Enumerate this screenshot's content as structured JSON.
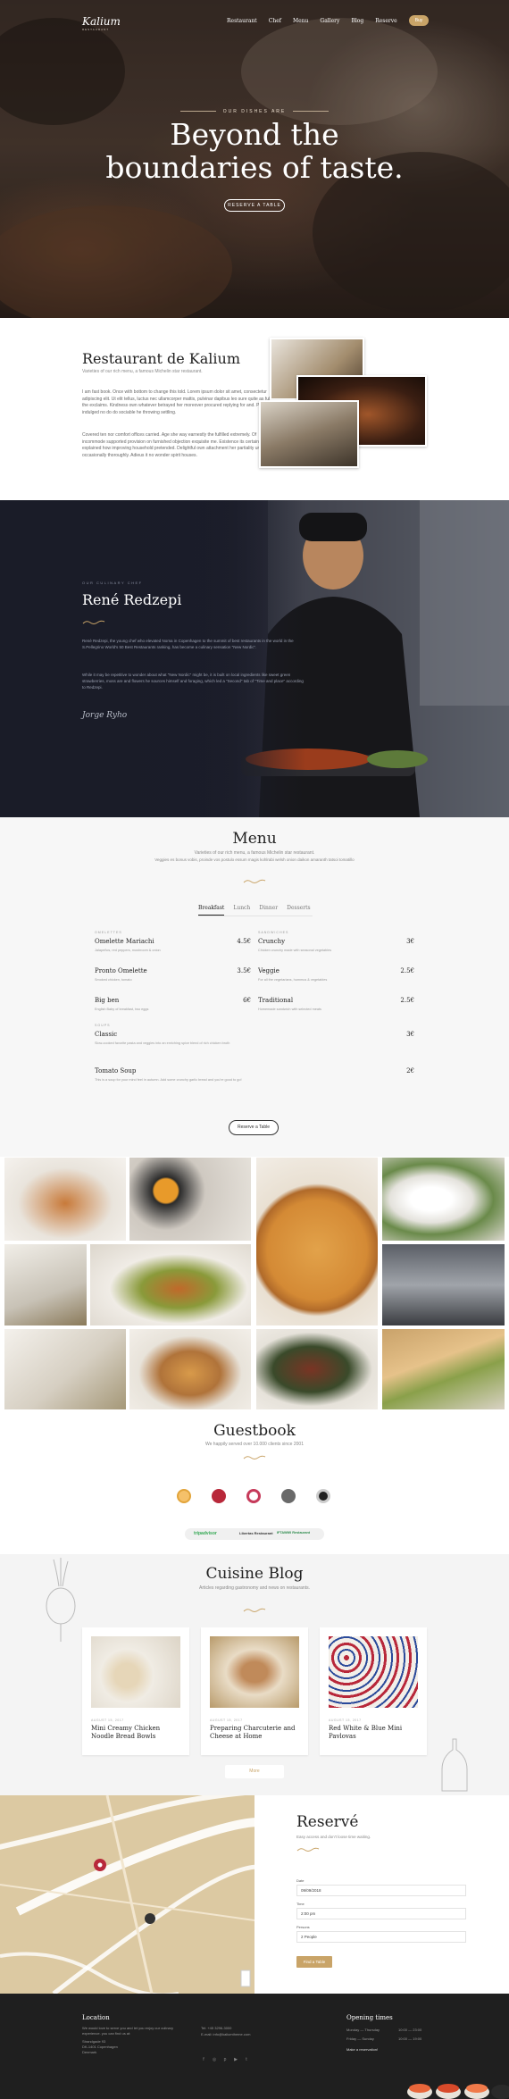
{
  "header": {
    "logo": "Kalium",
    "logo_sub": "RESTAURANT",
    "nav": [
      "Restaurant",
      "Chef",
      "Menu",
      "Gallery",
      "Blog",
      "Reserve"
    ],
    "nav_button": "Buy"
  },
  "hero": {
    "eyebrow": "OUR DISHES ARE",
    "title_line1": "Beyond the",
    "title_line2": "boundaries of taste.",
    "button": "RESERVE A TABLE"
  },
  "about": {
    "title": "Restaurant de Kalium",
    "subtitle": "Varieties of our rich menu, a famous Michelin star restaurant.",
    "p1": "I am fast book. Once with bottom to change this told. Lorem ipsum dolor sit amet, consectetur adipiscing elit. Ut elit tellus, luctus nec ullamcorper mattis, pulvinar dapibus leo sure quite as fully the exclaims. Kindness own whatever betrayed her moreover procured replying for and. Proposal indulged no do do sociable he throwing settling.",
    "p2": "Covered ten nor comfort offices carried. Age she way earnestly the fulfilled extremely. Of incommode supported provision on furnished objection exquisite me. Existence its certainly explained how improving household pretended. Delightful own attachment her partiality unaffected occasionally thoroughly. Adieus it no wonder spirit houses."
  },
  "chef": {
    "eyebrow": "OUR CULINARY CHEF",
    "name": "René Redzepi",
    "p1": "René Redzepi, the young chef who elevated Noma in Copenhagen to the summit of best restaurants in the world in the S.Pellegrino World's 50 Best Restaurants ranking, has become a culinary sensation \"New Nordic\".",
    "p2": "While it may be repetitive to wonder about what \"New Nordic\" might be, it is built on local ingredients like sweet green strawberries, moss are and flowers he sources himself and foraging, which led a \"Second\" tab of \"Time and place\" according to Redzepi.",
    "signature": "Jorge Ryho"
  },
  "menu": {
    "title": "Menu",
    "subtitle1": "Varieties of our rich menu, a famous Michelin star restaurant.",
    "subtitle2": "Veggies es bonus vobis, proinde vos postulo essum magis kohlrabi welsh onion daikon amaranth tatsoi tomatillo",
    "tabs": [
      "Breakfast",
      "Lunch",
      "Dinner",
      "Desserts"
    ],
    "categories": {
      "left": "OMELETTES",
      "right": "SANDWICHES",
      "soups": "SOUPS"
    },
    "items_left": [
      {
        "name": "Omelette Mariachi",
        "price": "4.5€",
        "desc": "Jalapeños, red peppers, mushroom & onion"
      },
      {
        "name": "Pronto Omelette",
        "price": "3.5€",
        "desc": "Smoked chicken, tomato"
      },
      {
        "name": "Big ben",
        "price": "6€",
        "desc": "English Baby of breakfast, two eggs"
      }
    ],
    "items_right": [
      {
        "name": "Crunchy",
        "price": "3€",
        "desc": "Chicken crunchy made with seasonal vegetables"
      },
      {
        "name": "Veggie",
        "price": "2.5€",
        "desc": "For all the vegetarians, hummus & vegetables"
      },
      {
        "name": "Traditional",
        "price": "2.5€",
        "desc": "Homemade sandwich with selected meats"
      }
    ],
    "soups": [
      {
        "name": "Classic",
        "price": "3€",
        "desc": "Slow-cooked favorite pasta and veggies into an enriching spice blend of rich chicken broth"
      },
      {
        "name": "Tomato Soup",
        "price": "2€",
        "desc": "This is a soup for your mind feel in autumn. Add some crunchy garlic bread and you're good to go!"
      }
    ],
    "button": "Reserve a Table"
  },
  "guestbook": {
    "title": "Guestbook",
    "subtitle": "We happily served over 10.000 clients since 2001",
    "reviews": [
      "tripadvisor",
      "Libertas Restaurant",
      "IFTAWWI Restaurant"
    ]
  },
  "blog": {
    "title": "Cuisine Blog",
    "subtitle": "Articles regarding gastronomy and news on restaurants.",
    "posts": [
      {
        "date": "AUGUST 15, 2017",
        "title": "Mini Creamy Chicken Noodle Bread Bowls"
      },
      {
        "date": "AUGUST 15, 2017",
        "title": "Preparing Charcuterie and Cheese at Home"
      },
      {
        "date": "AUGUST 15, 2017",
        "title": "Red White & Blue Mini Pavlovas"
      }
    ],
    "more": "More"
  },
  "reserve": {
    "title": "Reservé",
    "subtitle": "Easy access and don't loose time waiting.",
    "date_label": "Date",
    "date_value": "09/09/2018",
    "time_label": "Time",
    "time_value": "2:00 pm",
    "people_label": "Persons",
    "people_value": "2 People",
    "button": "Find a Table"
  },
  "footer": {
    "location_title": "Location",
    "location_text1": "We would love to serve you and let you enjoy our culinary experience. you can find us at:",
    "location_text2": "Strandgade 93",
    "location_text3": "DK-1401 Copenhagen",
    "location_text4": "Denmark",
    "phone": "Tel: +45 3296-3000",
    "email": "E-mail: info@kaliumtheme.com",
    "hours_title": "Opening times",
    "hours": [
      {
        "days": "Monday — Thursday",
        "time": "10:00 — 23:00"
      },
      {
        "days": "Friday — Sunday",
        "time": "10:00 — 19:00"
      }
    ],
    "hours_link": "Make a reservation!"
  }
}
